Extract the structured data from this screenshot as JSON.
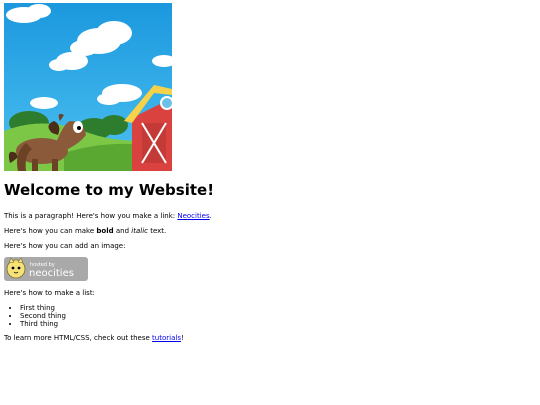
{
  "page": {
    "heading": "Welcome to my Website!",
    "paragraph1": {
      "before": "This is a paragraph! Here's how you make a link: ",
      "link_text": "Neocities",
      "after": "."
    },
    "paragraph2": {
      "before": "Here's how you can make ",
      "bold": "bold",
      "middle": " and ",
      "italic": "italic",
      "after": " text."
    },
    "paragraph3": "Here's how you can add an image:",
    "badge": {
      "small_text": "hosted by",
      "brand_text": "neocities"
    },
    "paragraph4": "Here's how to make a list:",
    "list_items": [
      "First thing",
      "Second thing",
      "Third thing"
    ],
    "paragraph5": {
      "before": "To learn more HTML/CSS, check out these ",
      "link_text": "tutorials",
      "after": "!"
    }
  },
  "colors": {
    "sky": "#27a8e8",
    "grass": "#6fbf3a",
    "barn_red": "#e04848",
    "link": "#0000ee",
    "badge_bg": "#a9a9a9"
  }
}
